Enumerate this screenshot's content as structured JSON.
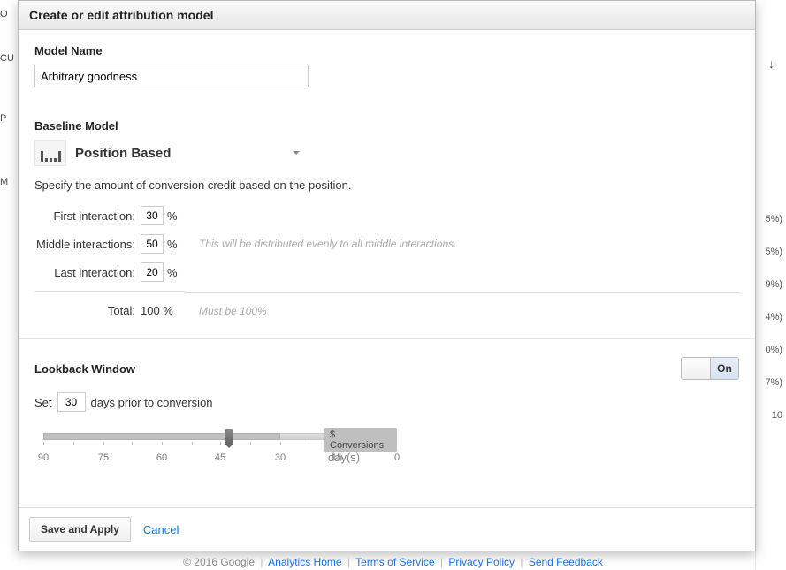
{
  "modal": {
    "title": "Create or edit attribution model",
    "model_name_label": "Model Name",
    "model_name_value": "Arbitrary goodness",
    "baseline_label": "Baseline Model",
    "baseline_value": "Position Based",
    "position_desc": "Specify the amount of conversion credit based on the position.",
    "credits": {
      "first_label": "First interaction:",
      "first_value": "30",
      "middle_label": "Middle interactions:",
      "middle_value": "50",
      "middle_hint": "This will be distributed evenly to all middle interactions.",
      "last_label": "Last interaction:",
      "last_value": "20",
      "pct": "%",
      "total_label": "Total:",
      "total_value": "100 %",
      "total_hint": "Must be 100%"
    },
    "lookback": {
      "label": "Lookback Window",
      "toggle_on": "On",
      "set_prefix": "Set",
      "days_value": "30",
      "set_suffix": "days prior to conversion",
      "badge": "$ Conversions",
      "unit": "day(s)",
      "ticks": [
        "90",
        "75",
        "60",
        "45",
        "30",
        "15",
        "0"
      ]
    },
    "footer": {
      "save": "Save and Apply",
      "cancel": "Cancel"
    }
  },
  "bg": {
    "left_labels": [
      "O",
      "CU",
      "P",
      "M"
    ],
    "right_values": [
      "5%)",
      "5%)",
      "9%)",
      "4%)",
      "0%)",
      "7%)",
      "10"
    ]
  },
  "ga_footer": {
    "copyright": "© 2016 Google",
    "links": [
      "Analytics Home",
      "Terms of Service",
      "Privacy Policy",
      "Send Feedback"
    ]
  }
}
